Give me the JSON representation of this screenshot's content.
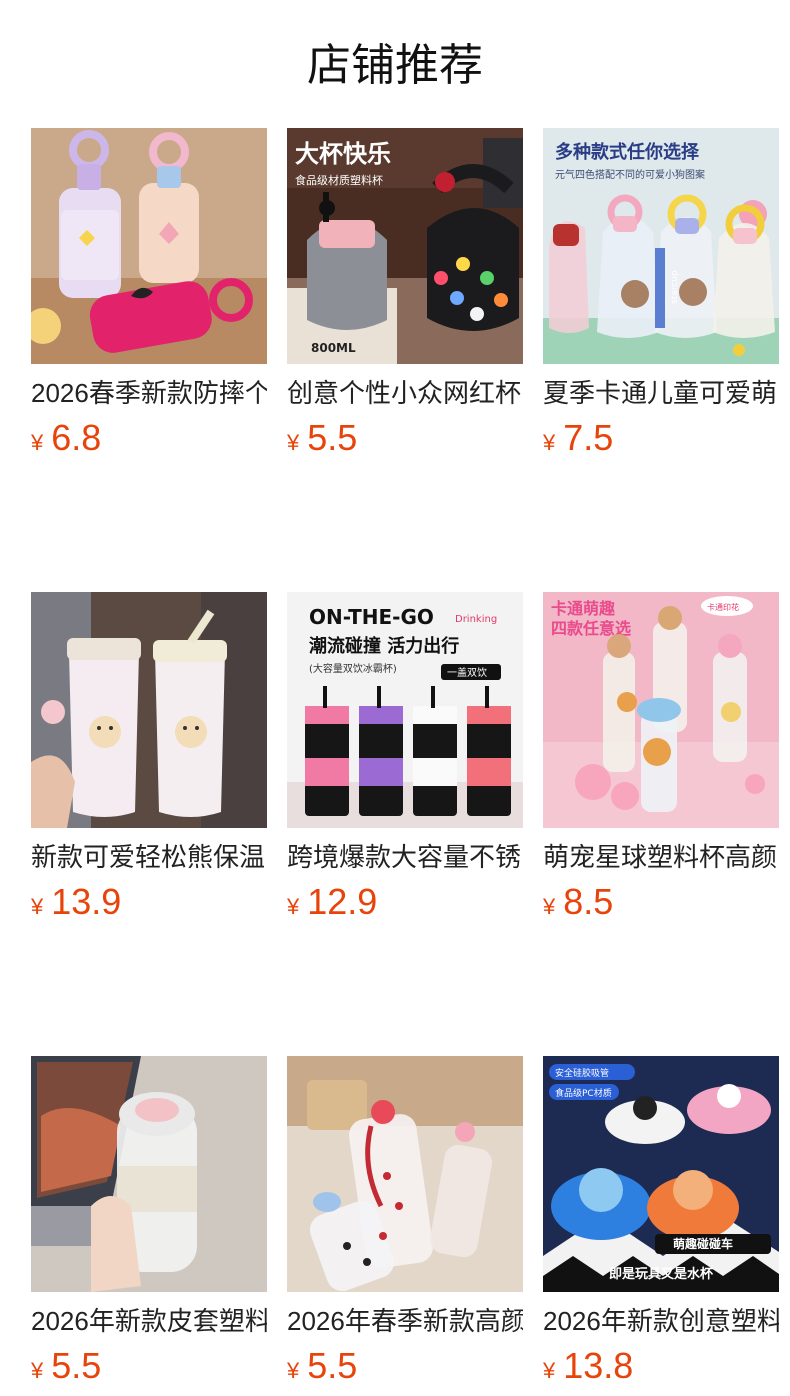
{
  "header": {
    "title": "店铺推荐"
  },
  "currency": "¥",
  "products": [
    {
      "name": "2026春季新款防摔个",
      "price": "6.8",
      "image_text": []
    },
    {
      "name": "创意个性小众网红杯",
      "price": "5.5",
      "image_text": [
        "大杯快乐",
        "食品级材质塑料杯",
        "800ML"
      ]
    },
    {
      "name": "夏季卡通儿童可爱萌",
      "price": "7.5",
      "image_text": [
        "多种款式任你选择",
        "元气四色搭配不同的可爱小狗图案",
        "starcup"
      ]
    },
    {
      "name": "新款可爱轻松熊保温",
      "price": "13.9",
      "image_text": []
    },
    {
      "name": "跨境爆款大容量不锈",
      "price": "12.9",
      "image_text": [
        "ON-THE-GO",
        "Drinking",
        "潮流碰撞 活力出行",
        "(大容量双饮冰霸杯)",
        "一盖双饮"
      ]
    },
    {
      "name": "萌宠星球塑料杯高颜",
      "price": "8.5",
      "image_text": [
        "卡通萌趣",
        "四款任意选",
        "卡通印花"
      ]
    },
    {
      "name": "2026年新款皮套塑料",
      "price": "5.5",
      "image_text": []
    },
    {
      "name": "2026年春季新款高颜",
      "price": "5.5",
      "image_text": []
    },
    {
      "name": "2026年新款创意塑料",
      "price": "13.8",
      "image_text": [
        "安全硅胶吸管",
        "食品级PC材质",
        "萌趣碰碰车",
        "即是玩具又是水杯"
      ]
    }
  ]
}
